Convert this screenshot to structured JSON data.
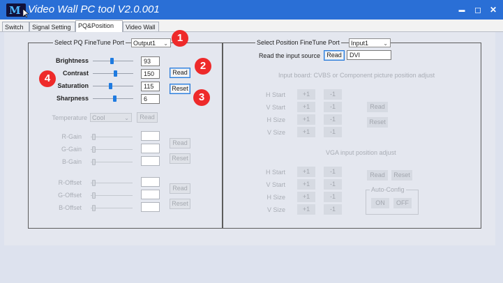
{
  "window": {
    "title": "Video Wall PC tool V2.0.001",
    "logo_text": "M",
    "minimize": "▬",
    "maximize": "◻",
    "close": "✕"
  },
  "tabs": [
    "Switch",
    "Signal Setting",
    "PQ&Position",
    "Video Wall"
  ],
  "pq": {
    "legend": "Select PQ FineTune Port",
    "port": "Output1",
    "brightness": {
      "label": "Brightness",
      "value": "93",
      "level": 0.48
    },
    "contrast": {
      "label": "Contrast",
      "value": "150",
      "level": 0.57
    },
    "saturation": {
      "label": "Saturation",
      "value": "115",
      "level": 0.44
    },
    "sharpness": {
      "label": "Sharpness",
      "value": "6",
      "level": 0.55
    },
    "read": "Read",
    "reset": "Reset",
    "temperature": {
      "label": "Temperature",
      "value": "Cool",
      "read": "Read"
    },
    "gain": {
      "r": "R-Gain",
      "g": "G-Gain",
      "b": "B-Gain",
      "read": "Read",
      "reset": "Reset"
    },
    "offset": {
      "r": "R-Offset",
      "g": "G-Offset",
      "b": "B-Offset",
      "read": "Read",
      "reset": "Reset"
    }
  },
  "position": {
    "legend": "Select Position FineTune Port",
    "port": "Input1",
    "read_source_label": "Read the input source",
    "read": "Read",
    "source": "DVI",
    "input_board": {
      "title": "Input board: CVBS or Component picture position adjust",
      "rows": [
        "H Start",
        "V Start",
        "H Size",
        "V Size"
      ],
      "plus": "+1",
      "minus": "-1",
      "read": "Read",
      "reset": "Reset"
    },
    "vga": {
      "title": "VGA input position adjust",
      "rows": [
        "H Start",
        "V Start",
        "H Size",
        "V Size"
      ],
      "plus": "+1",
      "minus": "-1",
      "read": "Read",
      "reset": "Reset",
      "auto_config": "Auto-Config",
      "on": "ON",
      "off": "OFF"
    }
  },
  "annotations": [
    "1",
    "2",
    "3",
    "4"
  ]
}
